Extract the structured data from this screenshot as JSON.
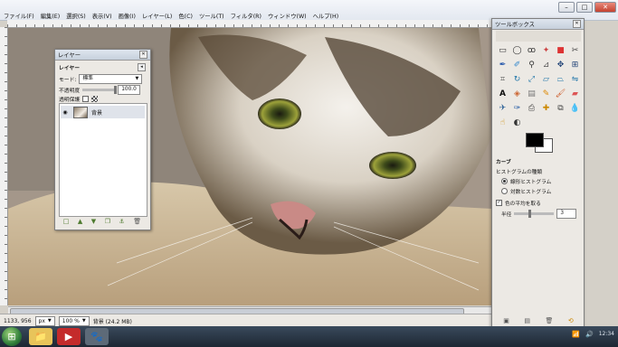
{
  "menubar": {
    "items": [
      "ファイル(F)",
      "編集(E)",
      "選択(S)",
      "表示(V)",
      "画像(I)",
      "レイヤー(L)",
      "色(C)",
      "ツール(T)",
      "フィルタ(R)",
      "ウィンドウ(W)",
      "ヘルプ(H)"
    ]
  },
  "window_controls": {
    "minimize": "–",
    "maximize": "□",
    "close": "✕"
  },
  "statusbar": {
    "coords": "1133, 956",
    "unit": "px",
    "zoom": "100 %",
    "info": "背景 (24.2 MB)"
  },
  "layers_dialog": {
    "title": "レイヤー",
    "header": "レイヤー",
    "mode_label": "モード:",
    "mode_value": "標準",
    "opacity_label": "不透明度",
    "opacity_value": "100.0",
    "lock_label": "透明保護",
    "layer_name": "背景",
    "buttons": [
      "new-layer",
      "raise-layer",
      "lower-layer",
      "duplicate-layer",
      "anchor-layer",
      "delete-layer"
    ]
  },
  "toolbox": {
    "title": "ツールボックス",
    "tools": [
      "rect-select",
      "ellipse-select",
      "free-select",
      "fuzzy-select",
      "select-by-color",
      "scissors",
      "paths",
      "color-picker",
      "zoom",
      "measure",
      "move",
      "align",
      "crop",
      "rotate",
      "scale",
      "shear",
      "perspective",
      "flip",
      "text",
      "bucket-fill",
      "blend",
      "pencil",
      "paintbrush",
      "eraser",
      "airbrush",
      "ink",
      "clone",
      "heal",
      "perspective-clone",
      "blur",
      "smudge",
      "dodge-burn"
    ],
    "fg_color": "#000000",
    "bg_color": "#ffffff",
    "curves": {
      "title": "カーブ",
      "histogram_label": "ヒストグラムの種類",
      "linear_label": "線形ヒストグラム",
      "log_label": "対数ヒストグラム",
      "average_label": "色の平均を取る",
      "radius_label": "半径",
      "radius_value": "3"
    }
  },
  "taskbar": {
    "apps": [
      "explorer",
      "media-player",
      "gimp"
    ],
    "tray_time": "12:34"
  }
}
